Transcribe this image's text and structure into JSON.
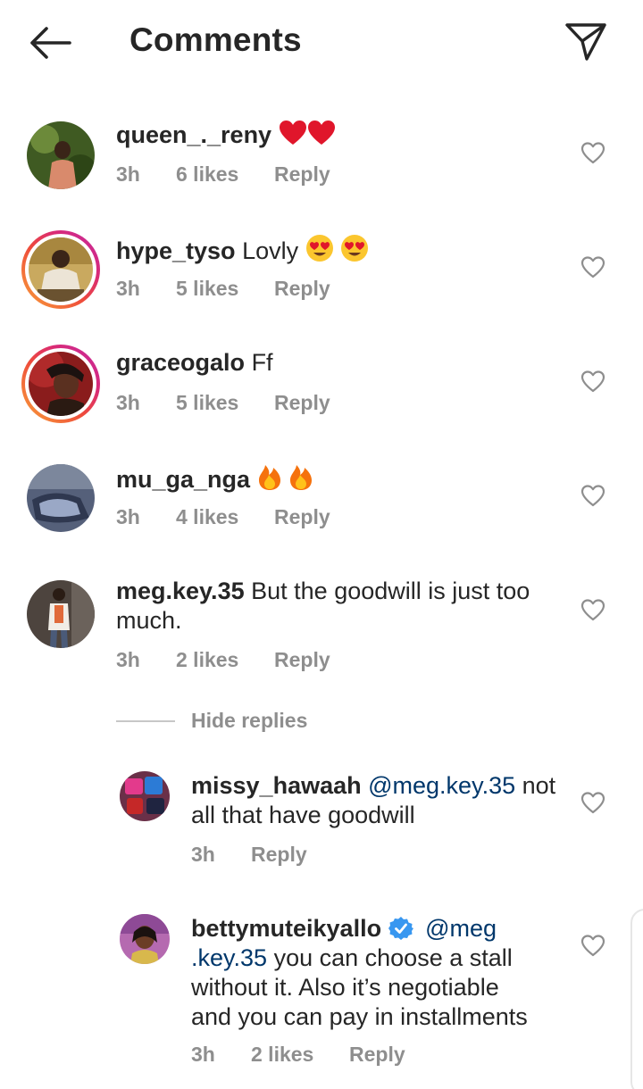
{
  "header": {
    "title": "Comments"
  },
  "comments": [
    {
      "username": "queen_._reny",
      "text": "",
      "time": "3h",
      "likes": "6 likes",
      "reply": "Reply"
    },
    {
      "username": "hype_tyso",
      "text": "Lovly",
      "time": "3h",
      "likes": "5 likes",
      "reply": "Reply"
    },
    {
      "username": "graceogalo",
      "text": "Ff",
      "time": "3h",
      "likes": "5 likes",
      "reply": "Reply"
    },
    {
      "username": "mu_ga_nga",
      "text": "",
      "time": "3h",
      "likes": "4 likes",
      "reply": "Reply"
    },
    {
      "username": "meg.key.35",
      "text_line1": "But the goodwill is just too",
      "text_line2": "much.",
      "time": "3h",
      "likes": "2 likes",
      "reply": "Reply"
    }
  ],
  "replies_toggle": {
    "label": "Hide replies"
  },
  "replies": [
    {
      "username": "missy_hawaah",
      "mention": "@meg.key.35",
      "text_line1_rest": "not",
      "text_line2": "all that have goodwill",
      "time": "3h",
      "reply": "Reply"
    },
    {
      "username": "bettymuteikyallo",
      "mention_part1": "@meg",
      "mention_part2": ".key.35",
      "text_line2_rest": "you can choose a stall",
      "text_line3": "without it. Also it’s negotiable",
      "text_line4": "and you can pay in installments",
      "time": "3h",
      "likes": "2 likes",
      "reply": "Reply"
    }
  ],
  "icons": {
    "back": "arrow-left-icon",
    "send": "paper-plane-icon",
    "like": "heart-outline-icon",
    "verified": "verified-badge-icon",
    "emoji_heart": "red-heart-emoji",
    "emoji_heart_eyes": "heart-eyes-emoji",
    "emoji_fire": "fire-emoji"
  },
  "colors": {
    "text": "#262626",
    "meta": "#8e8e8e",
    "mention": "#00376b",
    "verified": "#3897f0",
    "heart_emoji": "#e0162b"
  }
}
